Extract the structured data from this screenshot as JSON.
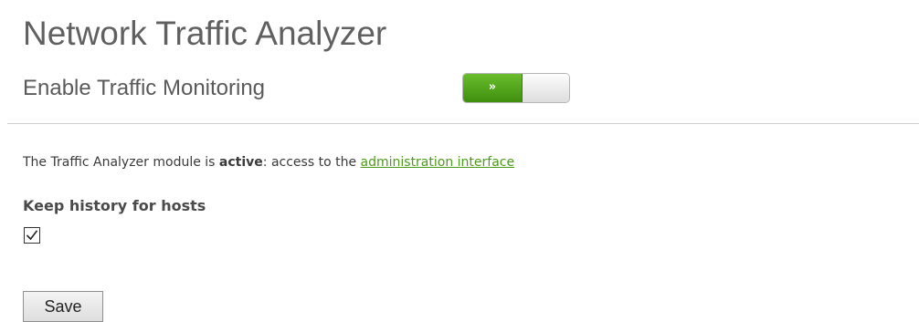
{
  "header": {
    "title": "Network Traffic Analyzer"
  },
  "monitoring": {
    "label": "Enable Traffic Monitoring",
    "toggle_state": "on",
    "toggle_glyph": "»",
    "toggle_on_color": "#4fa31a"
  },
  "status": {
    "prefix": "The Traffic Analyzer module is ",
    "state_word": "active",
    "middle": ": access to the ",
    "link_text": "administration interface",
    "link_color": "#4b9a1a"
  },
  "history": {
    "label": "Keep history for hosts",
    "checked": true
  },
  "form": {
    "save_label": "Save"
  }
}
